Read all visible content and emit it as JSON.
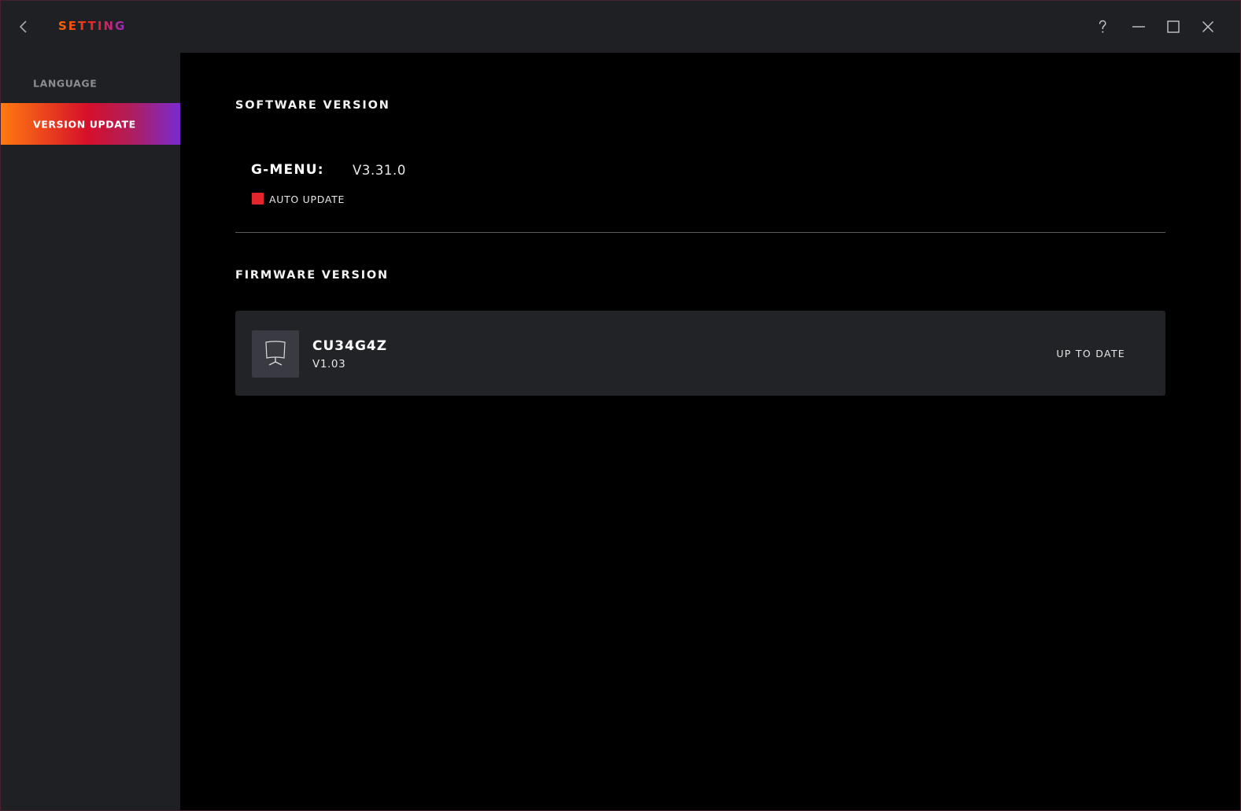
{
  "header": {
    "title": "SETTING",
    "icons": {
      "back": "chevron-left-icon",
      "help": "question-mark-icon",
      "minimize": "minimize-icon",
      "maximize": "maximize-icon",
      "close": "close-icon"
    }
  },
  "sidebar": {
    "items": [
      {
        "label": "LANGUAGE",
        "active": false
      },
      {
        "label": "VERSION UPDATE",
        "active": true
      }
    ]
  },
  "software": {
    "section_title": "SOFTWARE VERSION",
    "app_label": "G-MENU:",
    "app_version": "V3.31.0",
    "auto_update_label": "AUTO UPDATE",
    "auto_update_checked": true
  },
  "firmware": {
    "section_title": "FIRMWARE VERSION",
    "devices": [
      {
        "icon": "monitor-icon",
        "model": "CU34G4Z",
        "version": "V1.03",
        "status": "UP TO DATE"
      }
    ]
  },
  "colors": {
    "accent_orange": "#ff7a10",
    "accent_red": "#d6102a",
    "accent_purple": "#7a2ad0",
    "checkbox_red": "#e3262b",
    "background": "#000000",
    "panel": "#1f2024"
  }
}
